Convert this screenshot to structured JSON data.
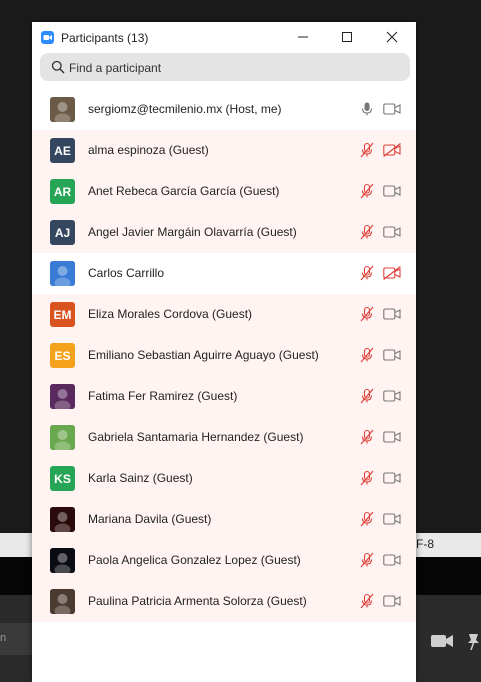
{
  "window": {
    "title": "Participants (13)"
  },
  "search": {
    "placeholder": "Find a participant"
  },
  "participants": [
    {
      "name": "sergiomz@tecmilenio.mx (Host, me)",
      "initials": "",
      "avatar_color": "#6b5a45",
      "avatar_type": "photo",
      "mic": "on",
      "video": "off",
      "tinted": false
    },
    {
      "name": "alma espinoza (Guest)",
      "initials": "AE",
      "avatar_color": "#34475e",
      "avatar_type": "initials",
      "mic": "muted",
      "video": "stopped",
      "tinted": true
    },
    {
      "name": "Anet Rebeca García García (Guest)",
      "initials": "AR",
      "avatar_color": "#27a556",
      "avatar_type": "initials",
      "mic": "muted",
      "video": "off",
      "tinted": true
    },
    {
      "name": "Angel Javier Margáin Olavarría (Guest)",
      "initials": "AJ",
      "avatar_color": "#34475e",
      "avatar_type": "initials",
      "mic": "muted",
      "video": "off",
      "tinted": true
    },
    {
      "name": "Carlos Carrillo",
      "initials": "",
      "avatar_color": "#3a7bd5",
      "avatar_type": "photo",
      "mic": "muted",
      "video": "stopped",
      "tinted": false
    },
    {
      "name": "Eliza Morales Cordova (Guest)",
      "initials": "EM",
      "avatar_color": "#d9531e",
      "avatar_type": "initials",
      "mic": "muted",
      "video": "off",
      "tinted": true
    },
    {
      "name": "Emiliano Sebastian Aguirre Aguayo (Guest)",
      "initials": "ES",
      "avatar_color": "#f4a21c",
      "avatar_type": "initials",
      "mic": "muted",
      "video": "off",
      "tinted": true
    },
    {
      "name": "Fatima Fer Ramirez (Guest)",
      "initials": "",
      "avatar_color": "#5a2a5e",
      "avatar_type": "photo",
      "mic": "muted",
      "video": "off",
      "tinted": true
    },
    {
      "name": "Gabriela Santamaria Hernandez (Guest)",
      "initials": "",
      "avatar_color": "#6aa84f",
      "avatar_type": "photo",
      "mic": "muted",
      "video": "off",
      "tinted": true
    },
    {
      "name": "Karla Sainz (Guest)",
      "initials": "KS",
      "avatar_color": "#27a556",
      "avatar_type": "initials",
      "mic": "muted",
      "video": "off",
      "tinted": true
    },
    {
      "name": "Mariana Davila (Guest)",
      "initials": "",
      "avatar_color": "#2a0a0a",
      "avatar_type": "photo",
      "mic": "muted",
      "video": "off",
      "tinted": true
    },
    {
      "name": "Paola Angelica Gonzalez Lopez (Guest)",
      "initials": "",
      "avatar_color": "#0b0b14",
      "avatar_type": "photo",
      "mic": "muted",
      "video": "off",
      "tinted": true
    },
    {
      "name": "Paulina Patricia Armenta Solorza (Guest)",
      "initials": "",
      "avatar_color": "#4a3a30",
      "avatar_type": "photo",
      "mic": "muted",
      "video": "off",
      "tinted": true
    }
  ],
  "background": {
    "strip_text": "F-8"
  },
  "colors": {
    "muted_red": "#e0403a",
    "icon_gray": "#777777",
    "row_tint": "#fff4f2",
    "zoom_blue": "#2d8cff"
  }
}
